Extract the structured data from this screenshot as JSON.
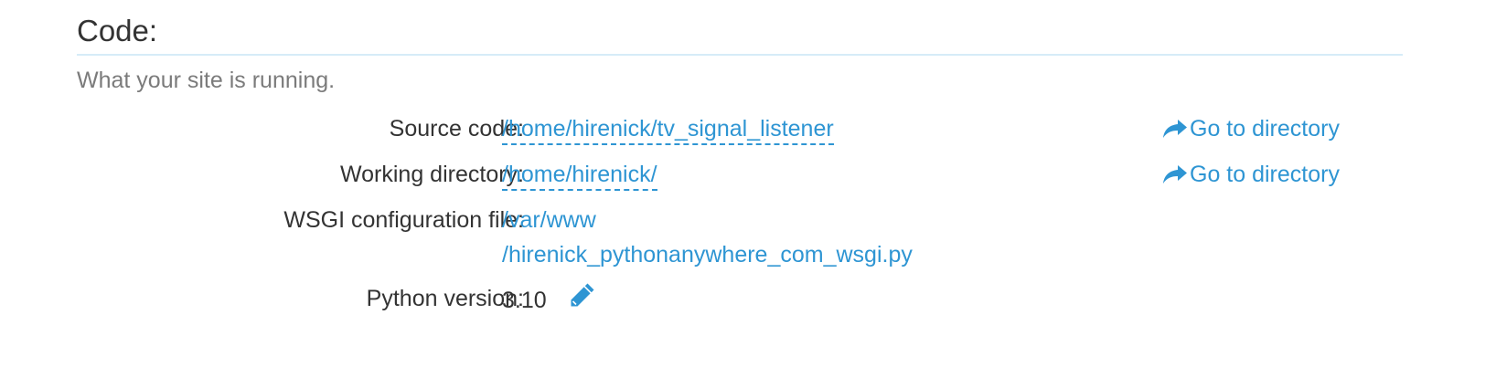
{
  "section": {
    "title": "Code:",
    "description": "What your site is running."
  },
  "rows": {
    "source_code": {
      "label": "Source code:",
      "value": "/home/hirenick/tv_signal_listener",
      "action": "Go to directory"
    },
    "working_directory": {
      "label": "Working directory:",
      "value": "/home/hirenick/",
      "action": "Go to directory"
    },
    "wsgi": {
      "label": "WSGI configuration file:",
      "value_line1": "/var/www",
      "value_line2": "/hirenick_pythonanywhere_com_wsgi.py"
    },
    "python_version": {
      "label": "Python version:",
      "value": "3.10"
    }
  },
  "icons": {
    "go_to_directory": "share-arrow-icon",
    "edit": "pencil-icon"
  },
  "colors": {
    "link": "#2e95d3",
    "text": "#333333",
    "muted": "#7b7b7b",
    "rule": "#d6ecf8"
  }
}
